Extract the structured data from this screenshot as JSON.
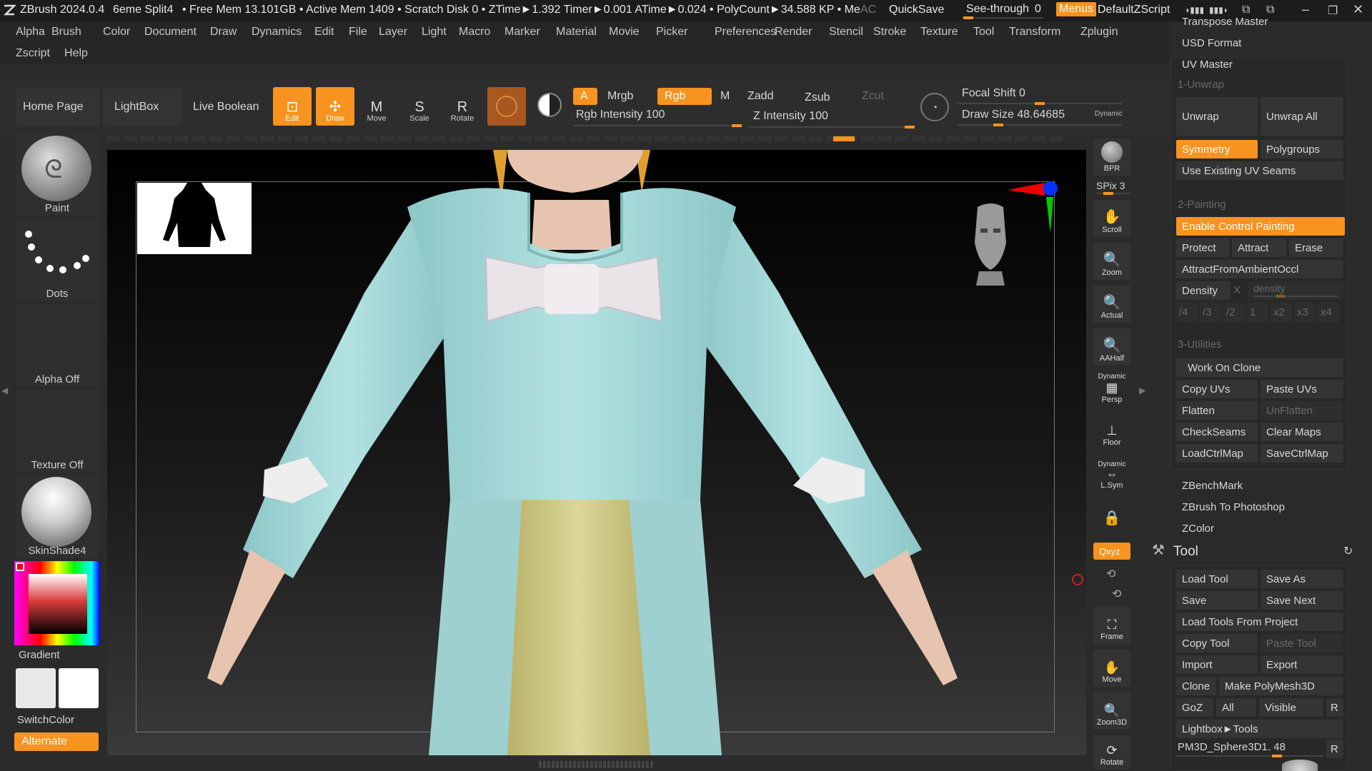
{
  "titlebar": {
    "app": "ZBrush 2024.0.4",
    "doc": "6eme Split4",
    "stats": "• Free Mem 13.101GB • Active Mem 1409 • Scratch Disk 0 • ZTime►1.392 Timer►0.001 ATime►0.024 • PolyCount►34.588 KP • Me",
    "ac": "AC",
    "quicksave": "QuickSave",
    "seethrough": "See-through",
    "seethrough_value": "0",
    "menus": "Menus",
    "defaultzscript": "DefaultZScript"
  },
  "menubar": {
    "row1": [
      "Alpha",
      "Brush",
      "Color",
      "Document",
      "Draw",
      "Dynamics",
      "Edit",
      "File",
      "Layer",
      "Light",
      "Macro",
      "Marker",
      "Material",
      "Movie",
      "Picker",
      "Preferences",
      "Render",
      "Stencil",
      "Stroke",
      "Texture",
      "Tool",
      "Transform",
      "Zplugin"
    ],
    "row2": [
      "Zscript",
      "Help"
    ]
  },
  "toolbar": {
    "home": "Home Page",
    "lightbox": "LightBox",
    "liveboolean": "Live Boolean",
    "edit": "Edit",
    "draw": "Draw",
    "move": "Move",
    "scale": "Scale",
    "rotate": "Rotate",
    "a": "A",
    "mrgb": "Mrgb",
    "rgb": "Rgb",
    "m": "M",
    "zadd": "Zadd",
    "zsub": "Zsub",
    "zcut": "Zcut",
    "rgb_intensity": "Rgb Intensity 100",
    "z_intensity": "Z Intensity 100",
    "focal_shift": "Focal Shift 0",
    "draw_size": "Draw Size 48.64685",
    "dynamic": "Dynamic",
    "rgb_intensity_level": 1.0,
    "z_intensity_level": 1.0
  },
  "leftshelf": {
    "paint": "Paint",
    "dots": "Dots",
    "alpha": "Alpha Off",
    "texture": "Texture Off",
    "material": "SkinShade4",
    "gradient": "Gradient",
    "switchcolor": "SwitchColor",
    "alternate": "Alternate"
  },
  "righttools": {
    "bpr": "BPR",
    "spix": "SPix 3",
    "scroll": "Scroll",
    "zoom": "Zoom",
    "actual": "Actual",
    "aahalf": "AAHalf",
    "dynamic": "Dynamic",
    "persp": "Persp",
    "floor": "Floor",
    "lsym": "L.Sym",
    "xyz": "Qxyz",
    "frame": "Frame",
    "move": "Move",
    "zoom3d": "Zoom3D",
    "rotate": "Rotate"
  },
  "zplugin": {
    "transpose_master": "Transpose Master",
    "usd_format": "USD Format",
    "uv_master": "UV Master",
    "unwrap_section": "1-Unwrap",
    "unwrap": "Unwrap",
    "unwrap_all": "Unwrap All",
    "symmetry": "Symmetry",
    "polygroups": "Polygroups",
    "use_existing": "Use Existing UV Seams",
    "painting_section": "2-Painting",
    "enable_control": "Enable Control Painting",
    "protect": "Protect",
    "attract": "Attract",
    "erase": "Erase",
    "attract_ambient": "AttractFromAmbientOccl",
    "density": "Density",
    "density_x": "X",
    "density_ph": "density",
    "density_steps": [
      "/4",
      "/3",
      "/2",
      "1",
      "x2",
      "x3",
      "x4"
    ],
    "utilities_section": "3-Utilities",
    "work_on_clone": "Work On Clone",
    "copy_uvs": "Copy UVs",
    "paste_uvs": "Paste UVs",
    "flatten": "Flatten",
    "unflatten": "UnFlatten",
    "checkseams": "CheckSeams",
    "clear_maps": "Clear Maps",
    "loadctrlmap": "LoadCtrlMap",
    "savectrlmap": "SaveCtrlMap",
    "zbenchmark": "ZBenchMark",
    "zbrush_photoshop": "ZBrush To Photoshop",
    "zcolor": "ZColor"
  },
  "toolpanel": {
    "title": "Tool",
    "load_tool": "Load Tool",
    "save_as": "Save As",
    "save": "Save",
    "save_next": "Save Next",
    "load_from_project": "Load Tools From Project",
    "copy_tool": "Copy Tool",
    "paste_tool": "Paste Tool",
    "import": "Import",
    "export": "Export",
    "clone": "Clone",
    "make_polymesh": "Make PolyMesh3D",
    "goz": "GoZ",
    "all": "All",
    "visible": "Visible",
    "r": "R",
    "lightbox_tools": "Lightbox►Tools",
    "current_tool": "PM3D_Sphere3D1. 48",
    "r2": "R"
  },
  "colors": {
    "accent": "#f7931e",
    "shirt": "#a6d8d8",
    "pants": "#d4cf8a",
    "bow": "#e8e4e8",
    "skin": "#e6c4b0"
  }
}
